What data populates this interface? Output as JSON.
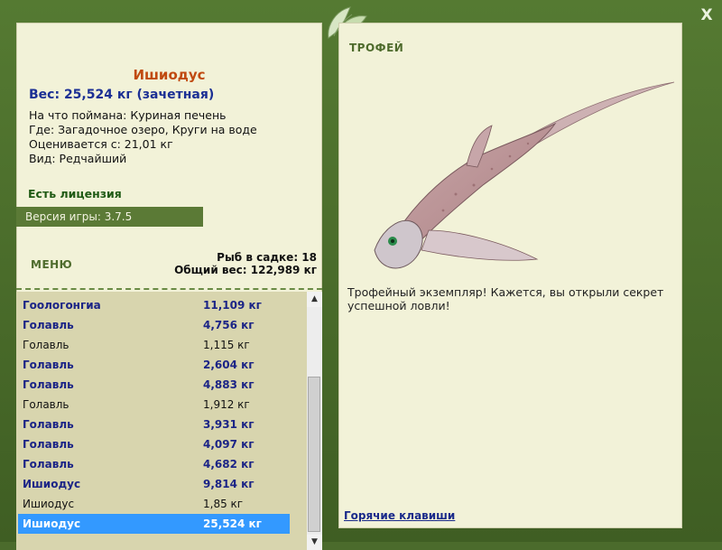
{
  "window": {
    "close_label": "X"
  },
  "catch": {
    "title": "Ишиодус",
    "weight": "Вес: 25,524 кг (зачетная)",
    "bait": "На что поймана: Куриная печень",
    "place": "Где: Загадочное озеро, Круги на воде",
    "price": "Оценивается с: 21,01 кг",
    "rarity": "Вид: Редчайший"
  },
  "license_text": "Есть лицензия",
  "version_text": "Версия игры: 3.7.5",
  "menu_label": "МЕНЮ",
  "stats": {
    "fish_in_keepnet": "Рыб в садке: 18",
    "total_weight": "Общий вес: 122,989 кг"
  },
  "fish_list": [
    {
      "name": "Гоологонгиа",
      "weight": "11,109 кг",
      "style": "bold"
    },
    {
      "name": "Голавль",
      "weight": "4,756 кг",
      "style": "bold"
    },
    {
      "name": "Голавль",
      "weight": "1,115 кг",
      "style": "plain"
    },
    {
      "name": "Голавль",
      "weight": "2,604 кг",
      "style": "bold"
    },
    {
      "name": "Голавль",
      "weight": "4,883 кг",
      "style": "bold"
    },
    {
      "name": "Голавль",
      "weight": "1,912 кг",
      "style": "plain"
    },
    {
      "name": "Голавль",
      "weight": "3,931 кг",
      "style": "bold"
    },
    {
      "name": "Голавль",
      "weight": "4,097 кг",
      "style": "bold"
    },
    {
      "name": "Голавль",
      "weight": "4,682 кг",
      "style": "bold"
    },
    {
      "name": "Ишиодус",
      "weight": "9,814 кг",
      "style": "bold"
    },
    {
      "name": "Ишиодус",
      "weight": "1,85 кг",
      "style": "plain"
    },
    {
      "name": "Ишиодус",
      "weight": "25,524 кг",
      "style": "selected"
    }
  ],
  "trophy": {
    "label": "ТРОФЕЙ",
    "text": "Трофейный экземпляр! Кажется, вы открыли секрет успешной ловли!",
    "hotkeys_link": "Горячие клавиши"
  },
  "colors": {
    "frame_green": "#4b6b2c",
    "panel_bg": "#f2f2d8",
    "title_orange": "#c04a10",
    "weight_blue": "#1b2f94",
    "selected_row": "#3399ff"
  }
}
